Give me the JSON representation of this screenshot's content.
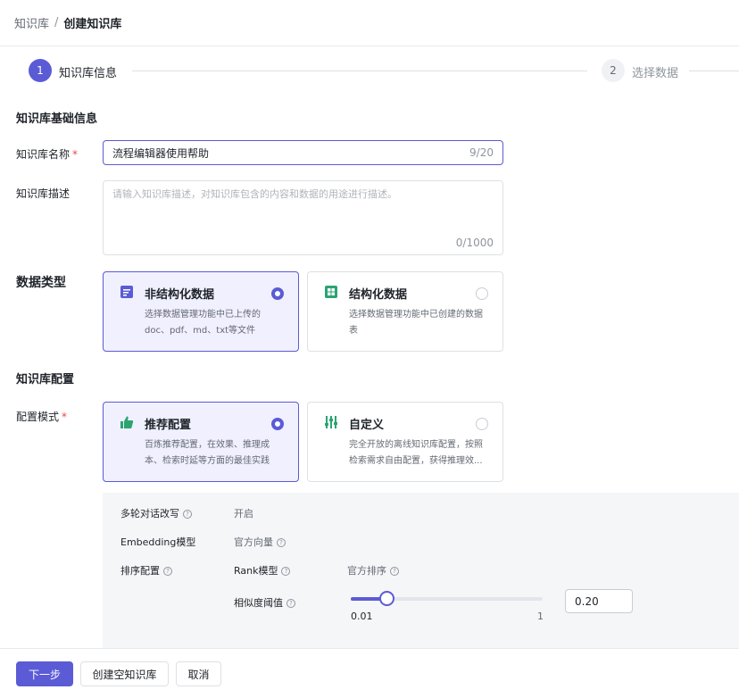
{
  "breadcrumb": {
    "parent": "知识库",
    "separator": "/",
    "current": "创建知识库"
  },
  "steps": [
    {
      "number": "1",
      "label": "知识库信息",
      "active": true
    },
    {
      "number": "2",
      "label": "选择数据",
      "active": false
    }
  ],
  "basic_info": {
    "title": "知识库基础信息",
    "name_label": "知识库名称",
    "required_mark": "*",
    "name_value": "流程编辑器使用帮助",
    "name_count": "9/20",
    "desc_label": "知识库描述",
    "desc_placeholder": "请输入知识库描述，对知识库包含的内容和数据的用途进行描述。",
    "desc_count": "0/1000"
  },
  "data_type": {
    "title": "数据类型",
    "options": [
      {
        "title": "非结构化数据",
        "desc": "选择数据管理功能中已上传的doc、pdf、md、txt等文件",
        "selected": true,
        "icon": "document-icon"
      },
      {
        "title": "结构化数据",
        "desc": "选择数据管理功能中已创建的数据表",
        "selected": false,
        "icon": "table-icon"
      }
    ]
  },
  "kb_config": {
    "title": "知识库配置",
    "mode_label": "配置模式",
    "required_mark": "*",
    "options": [
      {
        "title": "推荐配置",
        "desc": "百炼推荐配置，在效果、推理成本、检索时延等方面的最佳实践",
        "selected": true,
        "icon": "thumbs-up-icon"
      },
      {
        "title": "自定义",
        "desc": "完全开放的离线知识库配置，按照检索需求自由配置，获得推理效...",
        "selected": false,
        "icon": "sliders-icon"
      }
    ]
  },
  "config_details": {
    "multi_turn_label": "多轮对话改写",
    "multi_turn_value": "开启",
    "embedding_label": "Embedding模型",
    "embedding_value": "官方向量",
    "rerank_label": "排序配置",
    "rank_model_label": "Rank模型",
    "rank_model_value": "官方排序",
    "similarity_label": "相似度阈值",
    "slider_min": "0.01",
    "slider_max": "1",
    "similarity_value": "0.20",
    "slider_fraction": 0.19
  },
  "footer": {
    "next": "下一步",
    "create_empty": "创建空知识库",
    "cancel": "取消"
  },
  "colors": {
    "primary": "#5b5bd6",
    "card_selected_bg": "#f0f0ff",
    "panel_bg": "#f5f6f8"
  }
}
